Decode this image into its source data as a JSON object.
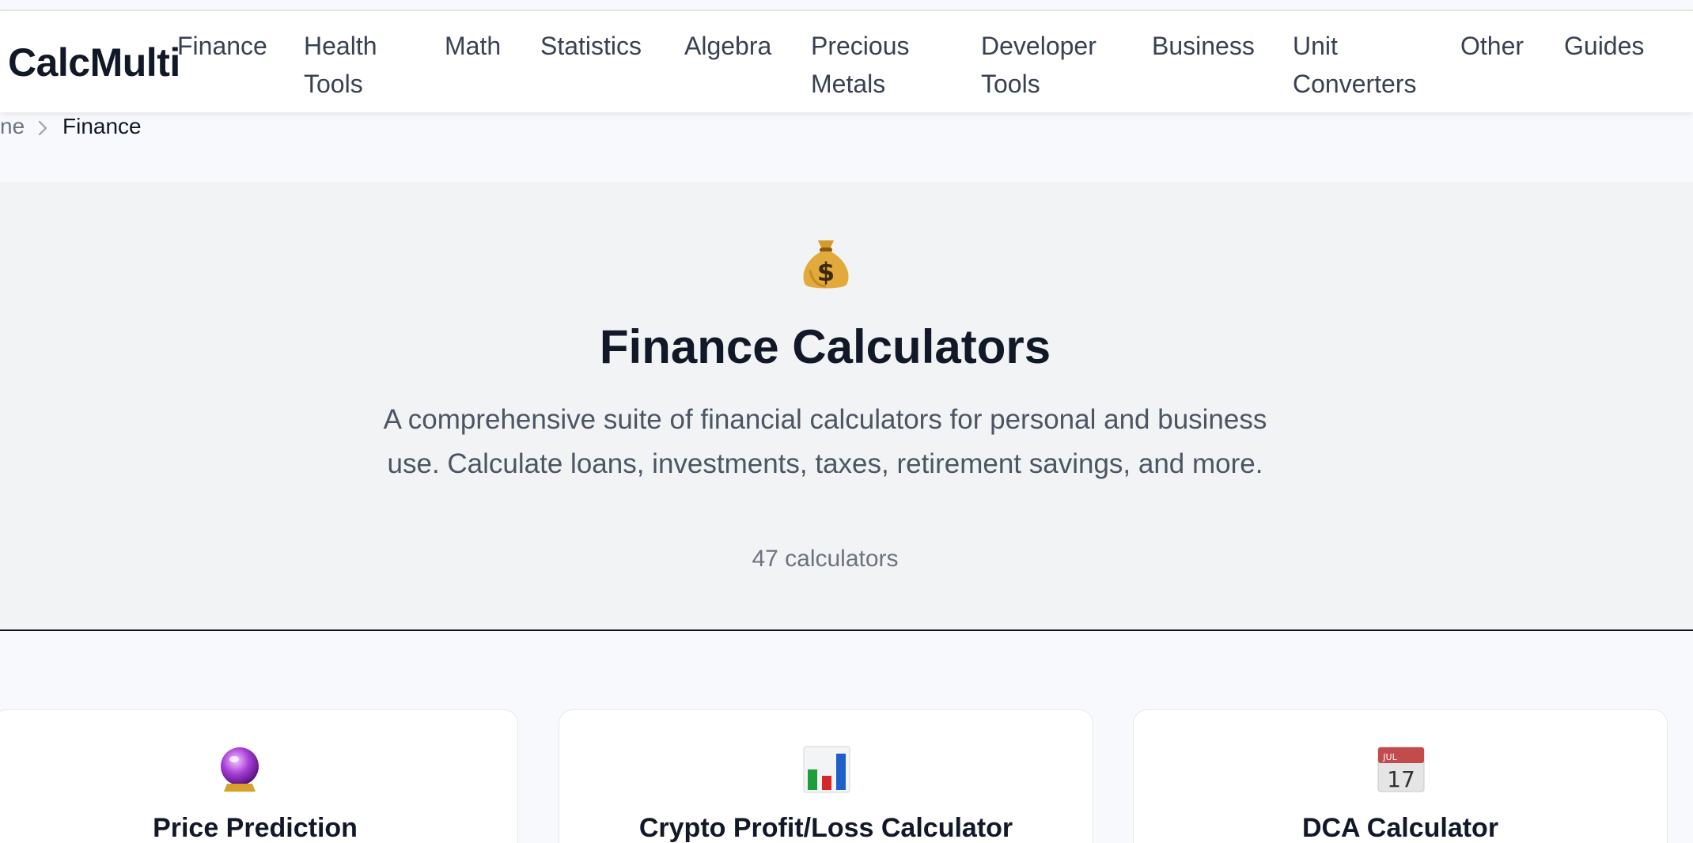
{
  "header": {
    "logo": "CalcMulti",
    "nav": [
      {
        "label": "Finance"
      },
      {
        "label": "Health\nTools"
      },
      {
        "label": "Math"
      },
      {
        "label": "Statistics"
      },
      {
        "label": "Algebra"
      },
      {
        "label": "Precious\nMetals"
      },
      {
        "label": "Developer\nTools"
      },
      {
        "label": "Business"
      },
      {
        "label": "Unit\nConverters"
      },
      {
        "label": "Other"
      },
      {
        "label": "Guides"
      }
    ]
  },
  "breadcrumb": {
    "home": "ne",
    "separator_icon": "chevron-right-icon",
    "current": "Finance"
  },
  "hero": {
    "icon": "money-bag-icon",
    "title": "Finance Calculators",
    "description": "A comprehensive suite of financial calculators for personal and business use. Calculate loans, investments, taxes, retirement savings, and more.",
    "count": "47 calculators"
  },
  "cards": [
    {
      "icon": "crystal-ball-icon",
      "title": "Price Prediction"
    },
    {
      "icon": "bar-chart-icon",
      "title": "Crypto Profit/Loss Calculator"
    },
    {
      "icon": "calendar-icon",
      "title": "DCA Calculator",
      "calendar_month": "JUL",
      "calendar_day": "17"
    }
  ],
  "colors": {
    "text_dark": "#111827",
    "text_muted": "#4b5563",
    "hero_bg": "#f2f3f5",
    "page_bg": "#f7f9fc"
  }
}
